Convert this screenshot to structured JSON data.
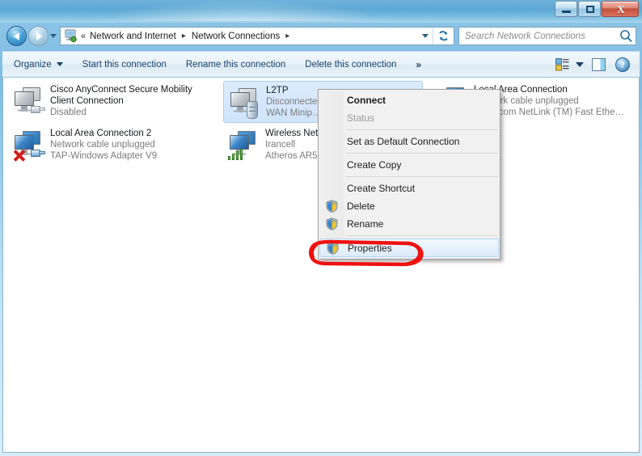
{
  "window": {
    "title": "",
    "buttons": {
      "minimize": "minimize",
      "maximize": "maximize",
      "close": "X"
    }
  },
  "address_bar": {
    "back_tooltip": "Back",
    "forward_tooltip": "Forward",
    "overflow_chevrons": "«",
    "breadcrumbs": [
      {
        "label": "Network and Internet",
        "separator": "▸"
      },
      {
        "label": "Network Connections",
        "separator": "▸"
      }
    ],
    "dropdown": "chevron-down",
    "refresh": "↻"
  },
  "search": {
    "placeholder": "Search Network Connections",
    "value": ""
  },
  "toolbar": {
    "organize_label": "Organize",
    "items": [
      "Start this connection",
      "Rename this connection",
      "Delete this connection"
    ],
    "overflow": "»",
    "help_label": "?"
  },
  "connections": [
    {
      "name": "Cisco AnyConnect Secure Mobility Client Connection",
      "status": "Disabled",
      "device": "",
      "icon": "network-adapter-disabled-icon",
      "selected": false,
      "column": 0,
      "row": 0,
      "wrap": true
    },
    {
      "name": "L2TP",
      "status": "Disconnected",
      "device": "WAN Minip…",
      "icon": "vpn-connection-icon",
      "selected": true,
      "column": 1,
      "row": 0,
      "wrap": false
    },
    {
      "name": "Local Area Connection",
      "status": "Network cable unplugged",
      "device": "Broadcom NetLink (TM) Fast Ethe…",
      "icon": "network-adapter-unplugged-icon",
      "selected": false,
      "column": 2,
      "row": 0,
      "wrap": false
    },
    {
      "name": "Local Area Connection 2",
      "status": "Network cable unplugged",
      "device": "TAP-Windows Adapter V9",
      "icon": "network-adapter-unplugged-icon",
      "selected": false,
      "column": 0,
      "row": 1,
      "wrap": false
    },
    {
      "name": "Wireless Network Connection",
      "status": "Irancell",
      "device": "Atheros AR5…",
      "icon": "wireless-adapter-icon",
      "selected": false,
      "column": 1,
      "row": 1,
      "wrap": false
    }
  ],
  "context_menu": {
    "items": [
      {
        "label": "Connect",
        "type": "item",
        "bold": true,
        "disabled": false,
        "shield": false,
        "highlight": false
      },
      {
        "label": "Status",
        "type": "item",
        "bold": false,
        "disabled": true,
        "shield": false,
        "highlight": false
      },
      {
        "label": "",
        "type": "separator"
      },
      {
        "label": "Set as Default Connection",
        "type": "item",
        "bold": false,
        "disabled": false,
        "shield": false,
        "highlight": false
      },
      {
        "label": "",
        "type": "separator"
      },
      {
        "label": "Create Copy",
        "type": "item",
        "bold": false,
        "disabled": false,
        "shield": false,
        "highlight": false
      },
      {
        "label": "",
        "type": "separator"
      },
      {
        "label": "Create Shortcut",
        "type": "item",
        "bold": false,
        "disabled": false,
        "shield": false,
        "highlight": false
      },
      {
        "label": "Delete",
        "type": "item",
        "bold": false,
        "disabled": false,
        "shield": true,
        "highlight": false
      },
      {
        "label": "Rename",
        "type": "item",
        "bold": false,
        "disabled": false,
        "shield": true,
        "highlight": false
      },
      {
        "label": "",
        "type": "separator"
      },
      {
        "label": "Properties",
        "type": "item",
        "bold": false,
        "disabled": false,
        "shield": true,
        "highlight": true
      }
    ]
  },
  "annotation": {
    "shape": "hand-drawn-red-oval",
    "target": "Properties",
    "color": "#ee1111"
  },
  "colors": {
    "accent": "#1a6aa8",
    "selection": "#cfe4fb",
    "menu_bg": "#f1f1f1",
    "annotation_red": "#ee1111",
    "disabled_text": "#9a9a9a",
    "sub_text": "#7b7b7b"
  }
}
